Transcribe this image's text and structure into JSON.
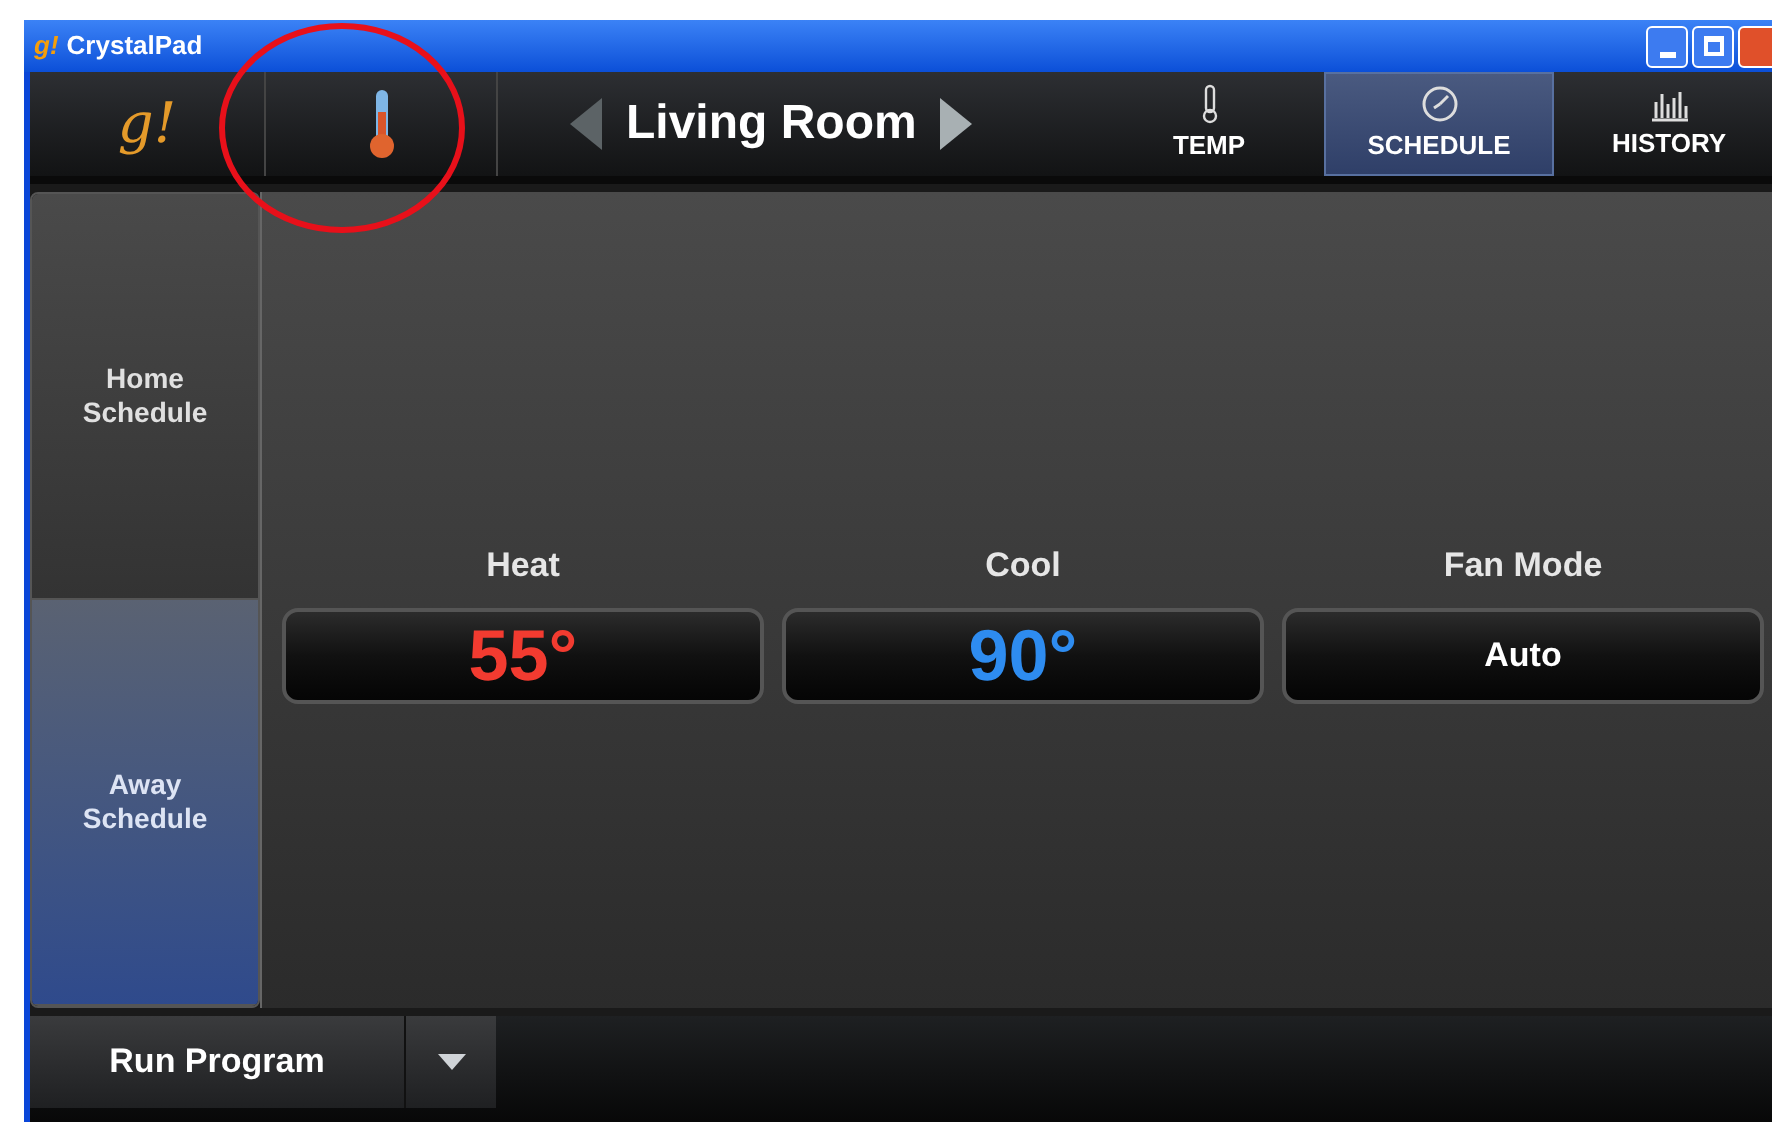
{
  "window": {
    "icon": "g!",
    "title": "CrystalPad"
  },
  "header": {
    "logo": "g!",
    "room": "Living Room",
    "tabs": [
      {
        "label": "TEMP",
        "kind": "temp",
        "selected": false
      },
      {
        "label": "SCHEDULE",
        "kind": "schedule",
        "selected": true
      },
      {
        "label": "HISTORY",
        "kind": "history",
        "selected": false
      }
    ]
  },
  "schedules": [
    {
      "label": "Home Schedule",
      "selected": false
    },
    {
      "label": "Away Schedule",
      "selected": true
    }
  ],
  "settings": [
    {
      "label": "Heat",
      "value": "55°",
      "kind": "heat"
    },
    {
      "label": "Cool",
      "value": "90°",
      "kind": "cool"
    },
    {
      "label": "Fan Mode",
      "value": "Auto",
      "kind": "fan"
    }
  ],
  "footer": {
    "program_button": "Run Program"
  }
}
